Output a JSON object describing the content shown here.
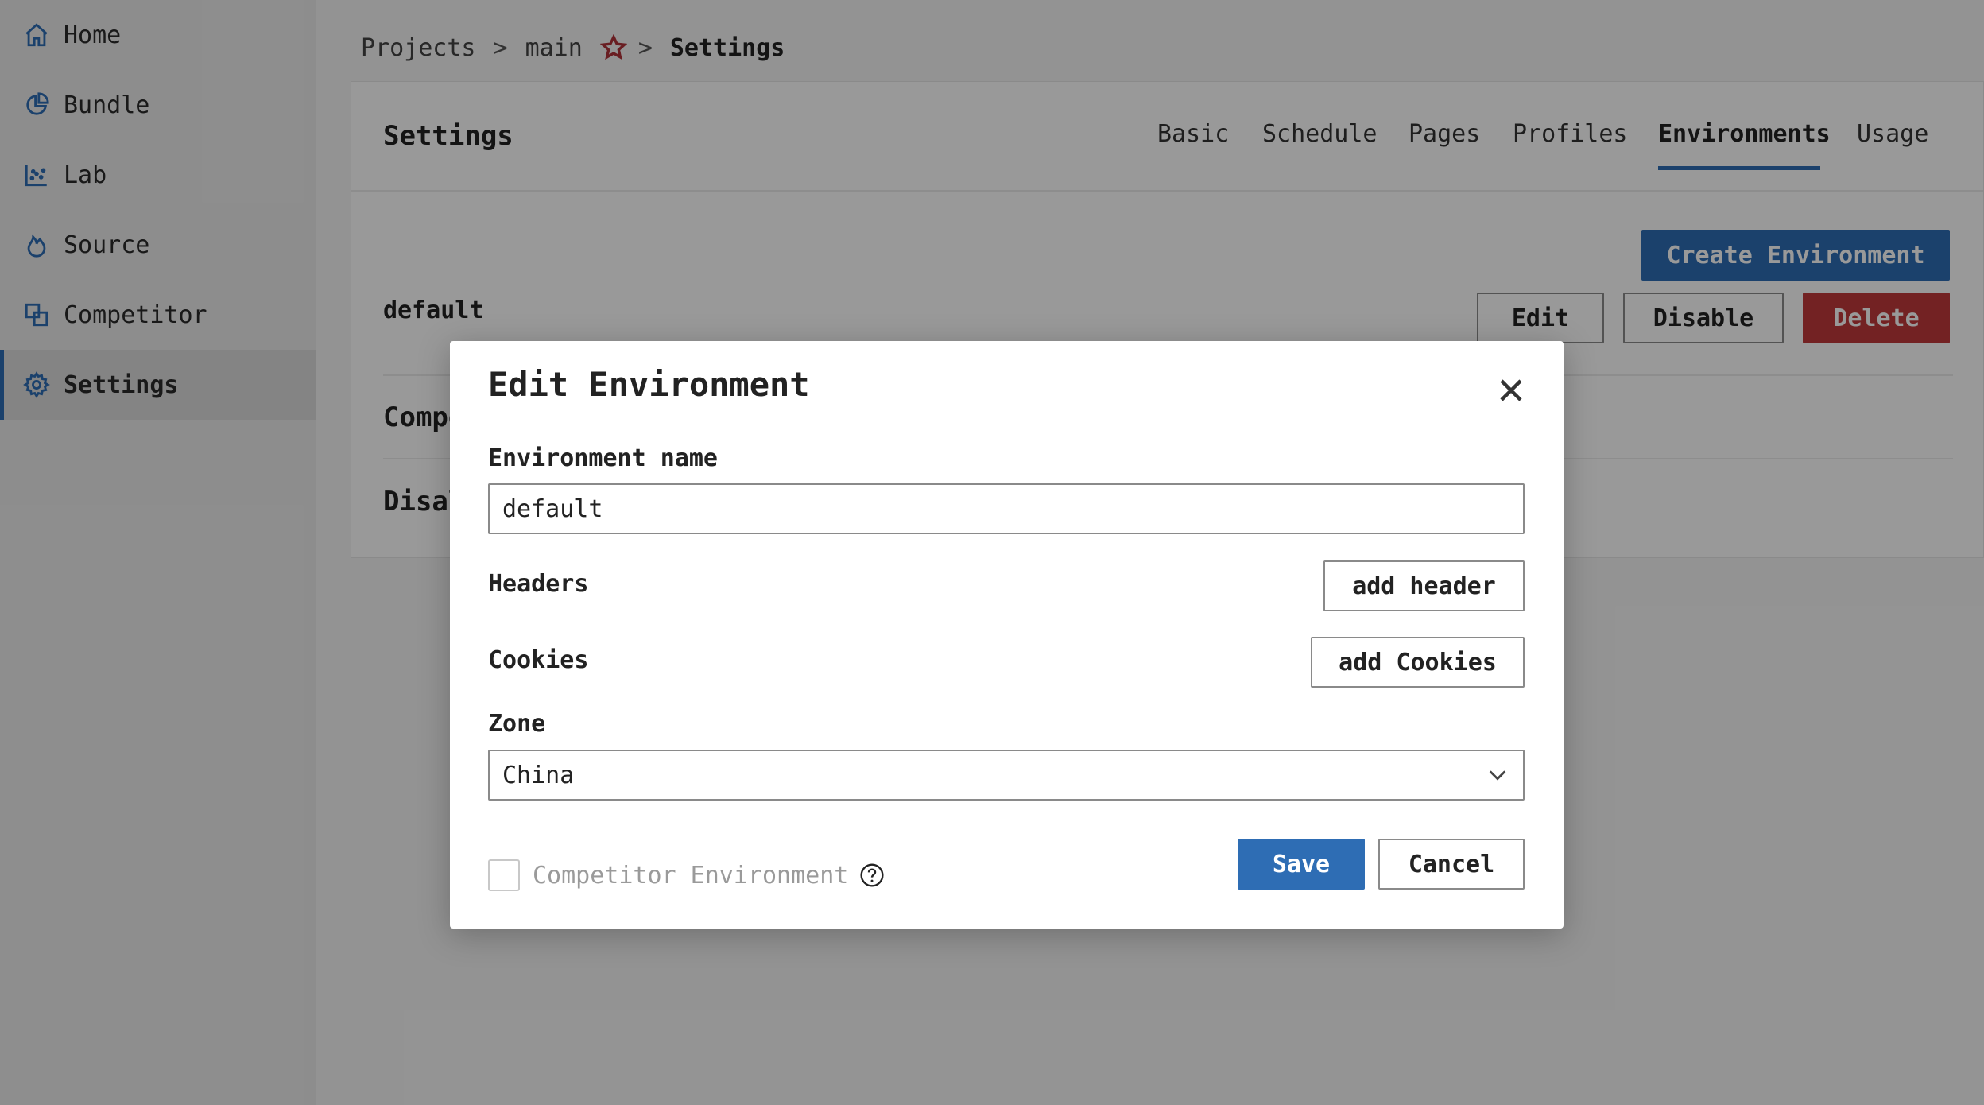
{
  "sidebar": {
    "items": [
      {
        "label": "Home",
        "icon": "home-icon"
      },
      {
        "label": "Bundle",
        "icon": "pie-chart-icon"
      },
      {
        "label": "Lab",
        "icon": "scatter-chart-icon"
      },
      {
        "label": "Source",
        "icon": "flame-icon"
      },
      {
        "label": "Competitor",
        "icon": "compare-icon"
      },
      {
        "label": "Settings",
        "icon": "gear-icon",
        "active": true
      }
    ]
  },
  "breadcrumb": {
    "projects": "Projects",
    "sep1": ">",
    "project": "main",
    "sep2": ">",
    "current": "Settings"
  },
  "settings": {
    "title": "Settings",
    "tabs": [
      {
        "label": "Basic"
      },
      {
        "label": "Schedule"
      },
      {
        "label": "Pages"
      },
      {
        "label": "Profiles"
      },
      {
        "label": "Environments",
        "active": true
      },
      {
        "label": "Usage"
      }
    ],
    "create_button": "Create Environment",
    "environment": {
      "name": "default",
      "edit_label": "Edit",
      "disable_label": "Disable",
      "delete_label": "Delete"
    },
    "competitor_section_partial": "Compe",
    "disabled_section_partial": "Disal"
  },
  "modal": {
    "title": "Edit Environment",
    "name_label": "Environment name",
    "name_value": "default",
    "headers_label": "Headers",
    "add_header_label": "add header",
    "cookies_label": "Cookies",
    "add_cookies_label": "add Cookies",
    "zone_label": "Zone",
    "zone_value": "China",
    "competitor_checkbox_label": "Competitor Environment",
    "competitor_checked": false,
    "save_label": "Save",
    "cancel_label": "Cancel"
  },
  "colors": {
    "accent": "#2e6db4",
    "danger": "#c0393b",
    "star": "#b0323a"
  }
}
